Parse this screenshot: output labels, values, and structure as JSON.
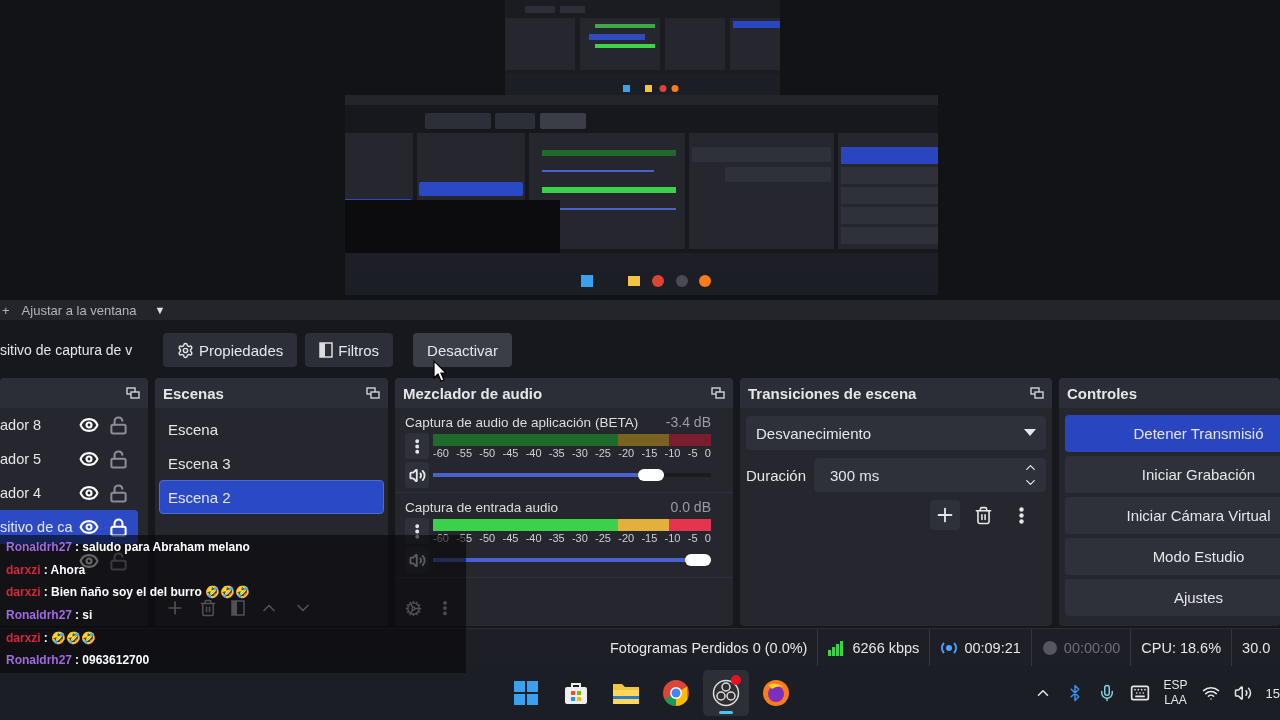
{
  "canvas_toolbar": {
    "add": "+",
    "label": "Ajustar a la ventana",
    "menu": "▼"
  },
  "source_toolbar": {
    "source_name": "sitivo de captura de v",
    "buttons": [
      {
        "label": "Propiedades",
        "kind": "gear",
        "hovered": false
      },
      {
        "label": "Filtros",
        "kind": "filter",
        "hovered": false
      },
      {
        "label": "Desactivar",
        "kind": "plain",
        "hovered": true
      }
    ]
  },
  "sources": {
    "items": [
      {
        "name": "ador 8",
        "visible": true,
        "locked": false,
        "selected": false
      },
      {
        "name": "ador 5",
        "visible": true,
        "locked": false,
        "selected": false
      },
      {
        "name": "ador 4",
        "visible": true,
        "locked": false,
        "selected": false
      },
      {
        "name": "sitivo de ca",
        "visible": true,
        "locked": true,
        "selected": true
      },
      {
        "visible": true,
        "locked": false,
        "selected": false
      }
    ]
  },
  "scenes": {
    "title": "Escenas",
    "items": [
      {
        "name": "Escena",
        "selected": false
      },
      {
        "name": "Escena 3",
        "selected": false
      },
      {
        "name": "Escena 2",
        "selected": true
      }
    ]
  },
  "mixer": {
    "title": "Mezclador de audio",
    "channels": [
      {
        "name": "Captura de audio de aplicación (BETA)",
        "reading": "-3.4 dB",
        "meter": {
          "level": 0
        },
        "scale": [
          "-60",
          "-55",
          "-50",
          "-45",
          "-40",
          "-35",
          "-30",
          "-25",
          "-20",
          "-15",
          "-10",
          "-5",
          "0"
        ],
        "volume": {
          "level": 0.83
        }
      },
      {
        "name": "Captura de entrada audio",
        "reading": "0.0 dB",
        "meter": {
          "level": 1
        },
        "scale": [
          "-60",
          "-55",
          "-50",
          "-45",
          "-40",
          "-35",
          "-30",
          "-25",
          "-20",
          "-15",
          "-10",
          "-5",
          "0"
        ],
        "volume": {
          "level": 1
        }
      }
    ]
  },
  "transitions": {
    "title": "Transiciones de escena",
    "type": "Desvanecimiento",
    "duration_label": "Duración",
    "duration": "300 ms"
  },
  "controls": {
    "title": "Controles",
    "buttons": [
      {
        "label": "Detener Transmisió",
        "active": true
      },
      {
        "label": "Iniciar Grabación",
        "active": false
      },
      {
        "label": "Iniciar Cámara Virtual",
        "active": false
      },
      {
        "label": "Modo Estudio",
        "active": false
      },
      {
        "label": "Ajustes",
        "active": false
      }
    ]
  },
  "status_bar": {
    "dropped_frames": "Fotogramas Perdidos 0 (0.0%)",
    "bitrate": "6266 kbps",
    "stream_time": "00:09:21",
    "record_time": "00:00:00",
    "cpu": "CPU: 18.6%",
    "fps": "30.0"
  },
  "chat": [
    {
      "user": "Ronaldrh27",
      "color": "#a06ae0",
      "message": ": saludo para Abraham melano"
    },
    {
      "user": "darxzi",
      "color": "#d4283a",
      "message": ": Ahora"
    },
    {
      "user": "darxzi",
      "color": "#d4283a",
      "message": ": Bien ñaño soy el del burro 🤣🤣🤣"
    },
    {
      "user": "Ronaldrh27",
      "color": "#a06ae0",
      "message": ": si"
    },
    {
      "user": "darxzi",
      "color": "#d4283a",
      "message": ": 🤣🤣🤣"
    },
    {
      "user": "Ronaldrh27",
      "color": "#a06ae0",
      "message": ": 0963612700"
    }
  ],
  "taskbar": {
    "apps": [
      {
        "kind": "windows",
        "selected": false,
        "badge": false
      },
      {
        "kind": "store",
        "selected": false,
        "badge": false
      },
      {
        "kind": "folder",
        "selected": false,
        "badge": false
      },
      {
        "kind": "chrome",
        "selected": false,
        "badge": false
      },
      {
        "kind": "obs",
        "selected": true,
        "badge": true
      },
      {
        "kind": "firefox",
        "selected": false,
        "badge": false
      }
    ],
    "language": [
      "ESP",
      "LAA"
    ],
    "clock": "15"
  }
}
